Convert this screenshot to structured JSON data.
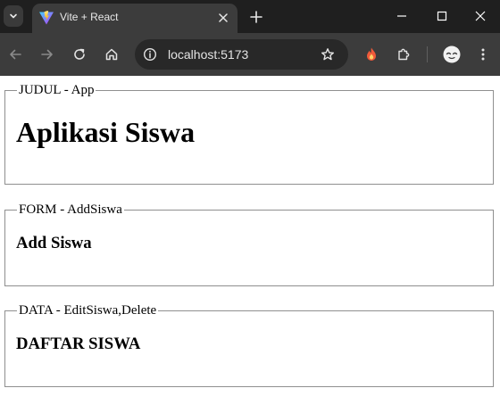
{
  "browser": {
    "tab": {
      "title": "Vite + React",
      "favicon": "vite-logo-icon"
    },
    "address_bar": {
      "url": "localhost:5173"
    },
    "icons": {
      "tab_search": "chevron-down-icon",
      "tab_close": "close-icon",
      "new_tab": "plus-icon",
      "minimize": "minimize-icon",
      "maximize": "maximize-icon",
      "close_window": "close-window-icon",
      "back": "back-arrow-icon",
      "forward": "forward-arrow-icon",
      "reload": "reload-icon",
      "home": "home-icon",
      "site_info": "site-info-icon",
      "bookmark": "star-icon",
      "extension_1": "flame-extension-icon",
      "extensions": "puzzle-icon",
      "profile": "avatar-icon",
      "menu": "kebab-menu-icon"
    },
    "colors": {
      "tabstrip": "#1f1f1f",
      "toolbar": "#3c3c3c",
      "omnibox": "#282828"
    }
  },
  "page": {
    "sections": [
      {
        "legend": "JUDUL - App",
        "heading": "Aplikasi Siswa"
      },
      {
        "legend": "FORM - AddSiswa",
        "heading": "Add Siswa"
      },
      {
        "legend": "DATA - EditSiswa,Delete",
        "heading": "DAFTAR SISWA"
      }
    ]
  }
}
